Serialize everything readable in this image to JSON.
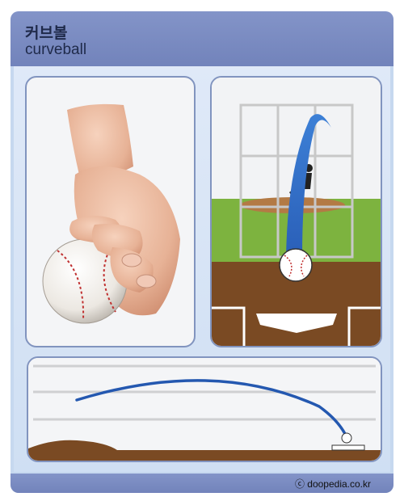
{
  "title": {
    "korean": "커브볼",
    "english": "curveball"
  },
  "credit": "ⓒ doopedia.co.kr",
  "colors": {
    "header": "#7a8bc2",
    "background": "#c6d8ef",
    "panel_border": "#8194bf",
    "trajectory": "#2458b0",
    "grass": "#7db33f",
    "dirt": "#7a4a23"
  },
  "icons": {
    "grip": "hand-holding-baseball",
    "ball": "baseball-icon"
  }
}
